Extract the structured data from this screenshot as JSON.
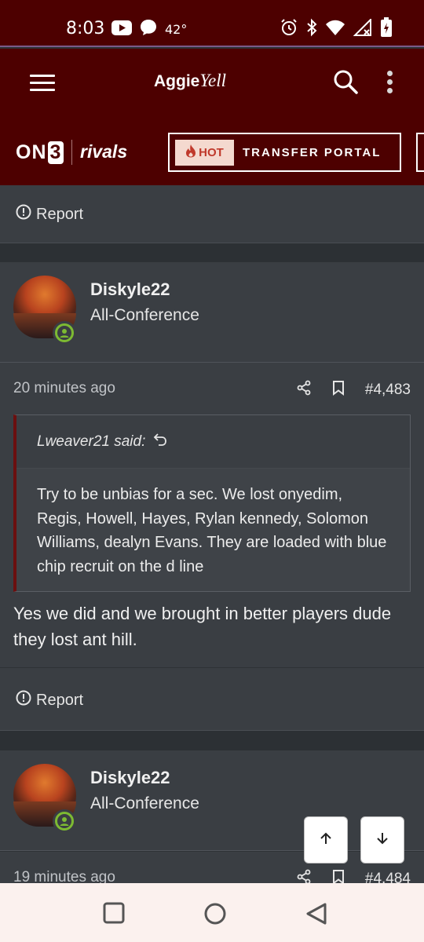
{
  "status_bar": {
    "time": "8:03",
    "temperature": "42°",
    "icons": [
      "youtube-icon",
      "chat-bubble-icon",
      "alarm-icon",
      "bluetooth-icon",
      "wifi-icon",
      "signal-icon",
      "battery-charging-icon"
    ]
  },
  "header": {
    "logo_bold": "Aggie",
    "logo_script": "Yell",
    "icons": [
      "menu-icon",
      "search-icon",
      "more-vertical-icon"
    ]
  },
  "brand_bar": {
    "on3_text": "ON",
    "on3_num": "3",
    "rivals": "rivals",
    "hot_badge": "HOT",
    "portal_label": "TRANSFER PORTAL"
  },
  "report_label": "Report",
  "posts": [
    {
      "author": "Diskyle22",
      "title": "All-Conference",
      "time": "20 minutes ago",
      "number": "#4,483",
      "quote_author": "Lweaver21 said:",
      "quote_text": "Try to be unbias for a sec. We lost onyedim, Regis, Howell, Hayes, Rylan kennedy, Solomon Williams, dealyn Evans. They are loaded with blue chip recruit on the d line",
      "body": "Yes we did and we brought in better players dude they lost ant hill."
    },
    {
      "author": "Diskyle22",
      "title": "All-Conference",
      "time": "19 minutes ago",
      "number": "#4,484"
    }
  ],
  "colors": {
    "header_bg": "#4d0000",
    "card_bg": "#3a3e43",
    "page_bg": "#2c3034",
    "online_green": "#7dba32",
    "hot_red": "#c0392b"
  }
}
